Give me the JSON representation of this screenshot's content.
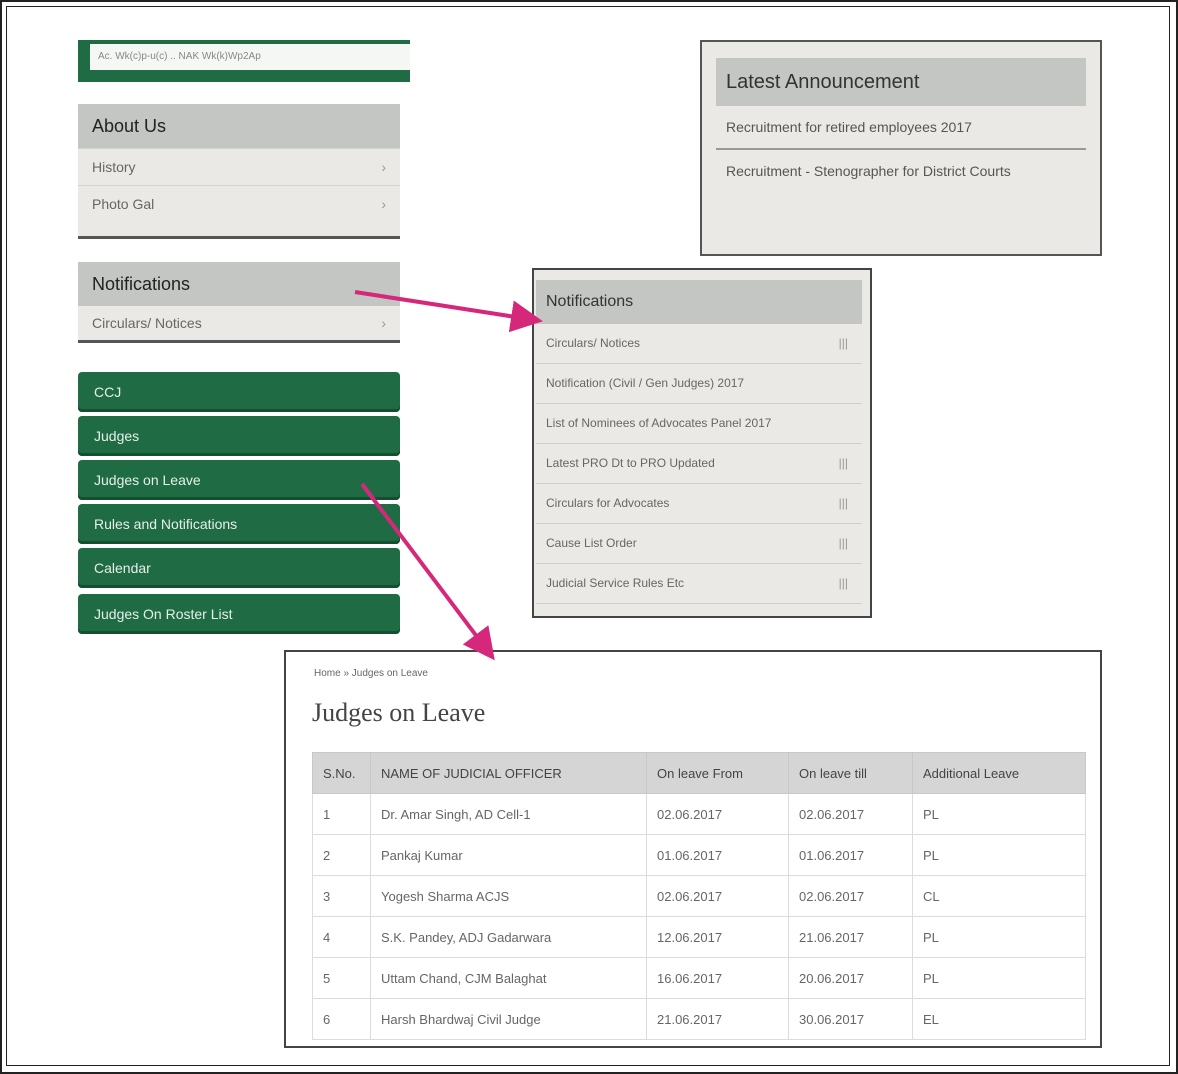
{
  "top_bar": {
    "text": "Ac.   Wk(c)p-u(c)   ..   NAK Wk(k)Wp2Ap"
  },
  "about_panel": {
    "title": "About Us",
    "items": [
      {
        "label": "History",
        "chevron": "›"
      },
      {
        "label": "Photo Gal",
        "chevron": "›"
      }
    ]
  },
  "notifications_panel": {
    "title": "Notifications",
    "items": [
      {
        "label": "Circulars/ Notices",
        "chevron": "›"
      }
    ]
  },
  "nav_buttons": [
    {
      "label": "CCJ"
    },
    {
      "label": "Judges"
    },
    {
      "label": "Judges on Leave"
    },
    {
      "label": "Rules and Notifications"
    },
    {
      "label": "Calendar"
    },
    {
      "label": "Judges On Roster List"
    }
  ],
  "announcement": {
    "title": "Latest Announcement",
    "items": [
      {
        "text": "Recruitment for retired employees 2017"
      },
      {
        "text": "Recruitment - Stenographer for District Courts"
      }
    ]
  },
  "notifications_box": {
    "title": "Notifications",
    "items": [
      {
        "label": "Circulars/ Notices",
        "chevron": "|||"
      },
      {
        "label": "Notification (Civil / Gen Judges) 2017",
        "chevron": ""
      },
      {
        "label": "List of Nominees of Advocates Panel 2017",
        "chevron": ""
      },
      {
        "label": "Latest PRO Dt to PRO Updated",
        "chevron": "|||"
      },
      {
        "label": "Circulars for Advocates",
        "chevron": "|||"
      },
      {
        "label": "Cause List Order",
        "chevron": "|||"
      },
      {
        "label": "Judicial Service Rules Etc",
        "chevron": "|||"
      }
    ]
  },
  "judges_page": {
    "breadcrumb": "Home » Judges on Leave",
    "title": "Judges on Leave",
    "table": {
      "headers": [
        "S.No.",
        "NAME OF JUDICIAL OFFICER",
        "On leave From",
        "On leave till",
        "Additional Leave"
      ],
      "rows": [
        [
          "1",
          "Dr. Amar Singh, AD Cell-1",
          "02.06.2017",
          "02.06.2017",
          "PL"
        ],
        [
          "2",
          "Pankaj Kumar",
          "01.06.2017",
          "01.06.2017",
          "PL"
        ],
        [
          "3",
          "Yogesh Sharma ACJS",
          "02.06.2017",
          "02.06.2017",
          "CL"
        ],
        [
          "4",
          "S.K. Pandey, ADJ Gadarwara",
          "12.06.2017",
          "21.06.2017",
          "PL"
        ],
        [
          "5",
          "Uttam Chand, CJM Balaghat",
          "16.06.2017",
          "20.06.2017",
          "PL"
        ],
        [
          "6",
          "Harsh Bhardwaj Civil Judge",
          "21.06.2017",
          "30.06.2017",
          "EL"
        ]
      ]
    }
  },
  "colors": {
    "green": "#1f6b44",
    "arrow": "#d6287a",
    "panel_header": "#c3c6c2"
  }
}
